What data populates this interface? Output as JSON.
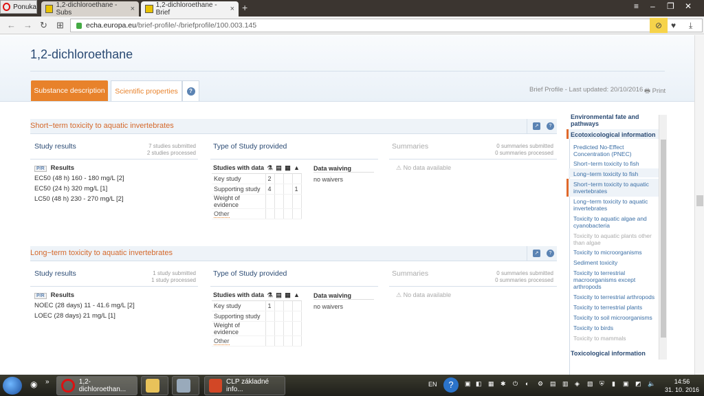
{
  "browser": {
    "menu_label": "Ponuka",
    "tabs": [
      {
        "label": "1,2-dichloroethane - Subs",
        "active": false
      },
      {
        "label": "1,2-dichloroethane - Brief",
        "active": true
      }
    ],
    "url_host": "echa.europa.eu",
    "url_path": "/brief-profile/-/briefprofile/100.003.145"
  },
  "page": {
    "title": "1,2-dichloroethane",
    "tab_substance": "Substance description",
    "tab_scientific": "Scientific properties",
    "updated": "Brief Profile - Last updated: 20/10/2016",
    "print": "Print"
  },
  "sections": [
    {
      "title": "Short−term toxicity to aquatic invertebrates",
      "study_results": "Study results",
      "submitted": "7 studies submitted",
      "processed": "2 studies processed",
      "badge": "P/R",
      "results_label": "Results",
      "results": [
        "EC50 (48 h) 160 - 180 mg/L [2]",
        "EC50 (24 h) 320 mg/L [1]",
        "LC50 (48 h) 230 - 270 mg/L [2]"
      ],
      "type_title": "Type of Study provided",
      "studies_with_data": "Studies with data",
      "rows": [
        {
          "label": "Key study",
          "c1": "2",
          "c2": "",
          "c3": "",
          "c4": ""
        },
        {
          "label": "Supporting study",
          "c1": "4",
          "c2": "",
          "c3": "",
          "c4": "1"
        },
        {
          "label": "Weight of evidence",
          "c1": "",
          "c2": "",
          "c3": "",
          "c4": ""
        },
        {
          "label": "Other",
          "c1": "",
          "c2": "",
          "c3": "",
          "c4": ""
        }
      ],
      "waiving_label": "Data waiving",
      "waiving_value": "no waivers",
      "summaries": "Summaries",
      "summ_submitted": "0 summaries submitted",
      "summ_processed": "0 summaries processed",
      "no_data": "No data available"
    },
    {
      "title": "Long−term toxicity to aquatic invertebrates",
      "study_results": "Study results",
      "submitted": "1 study submitted",
      "processed": "1 study processed",
      "badge": "P/R",
      "results_label": "Results",
      "results": [
        "NOEC (28 days) 11 - 41.6 mg/L [2]",
        "LOEC (28 days) 21 mg/L [1]"
      ],
      "type_title": "Type of Study provided",
      "studies_with_data": "Studies with data",
      "rows": [
        {
          "label": "Key study",
          "c1": "1",
          "c2": "",
          "c3": "",
          "c4": ""
        },
        {
          "label": "Supporting study",
          "c1": "",
          "c2": "",
          "c3": "",
          "c4": ""
        },
        {
          "label": "Weight of evidence",
          "c1": "",
          "c2": "",
          "c3": "",
          "c4": ""
        },
        {
          "label": "Other",
          "c1": "",
          "c2": "",
          "c3": "",
          "c4": ""
        }
      ],
      "waiving_label": "Data waiving",
      "waiving_value": "no waivers",
      "summaries": "Summaries",
      "summ_submitted": "0 summaries submitted",
      "summ_processed": "0 summaries processed",
      "no_data": "No data available"
    }
  ],
  "rnav": {
    "g1": "Environmental fate and pathways",
    "g2": "Ecotoxicological information",
    "items": [
      "Predicted No-Effect Concentration (PNEC)",
      "Short−term toxicity to fish",
      "Long−term toxicity to fish",
      "Short−term toxicity to aquatic invertebrates",
      "Long−term toxicity to aquatic invertebrates",
      "Toxicity to aquatic algae and cyanobacteria",
      "Toxicity to aquatic plants other than algae",
      "Toxicity to microorganisms",
      "Sediment toxicity",
      "Toxicity to terrestrial macroorganisms except arthropods",
      "Toxicity to terrestrial arthropods",
      "Toxicity to terrestrial plants",
      "Toxicity to soil microorganisms",
      "Toxicity to birds",
      "Toxicity to mammals"
    ],
    "g3": "Toxicological information"
  },
  "taskbar": {
    "app1": "1,2-dichloroethan...",
    "app2": "CLP základné info...",
    "lang": "EN",
    "time": "14:56",
    "date": "31. 10. 2016"
  },
  "colors": {
    "accent_orange": "#e8822b",
    "title_blue": "#2a4a73",
    "link_blue": "#3a6ea5"
  }
}
